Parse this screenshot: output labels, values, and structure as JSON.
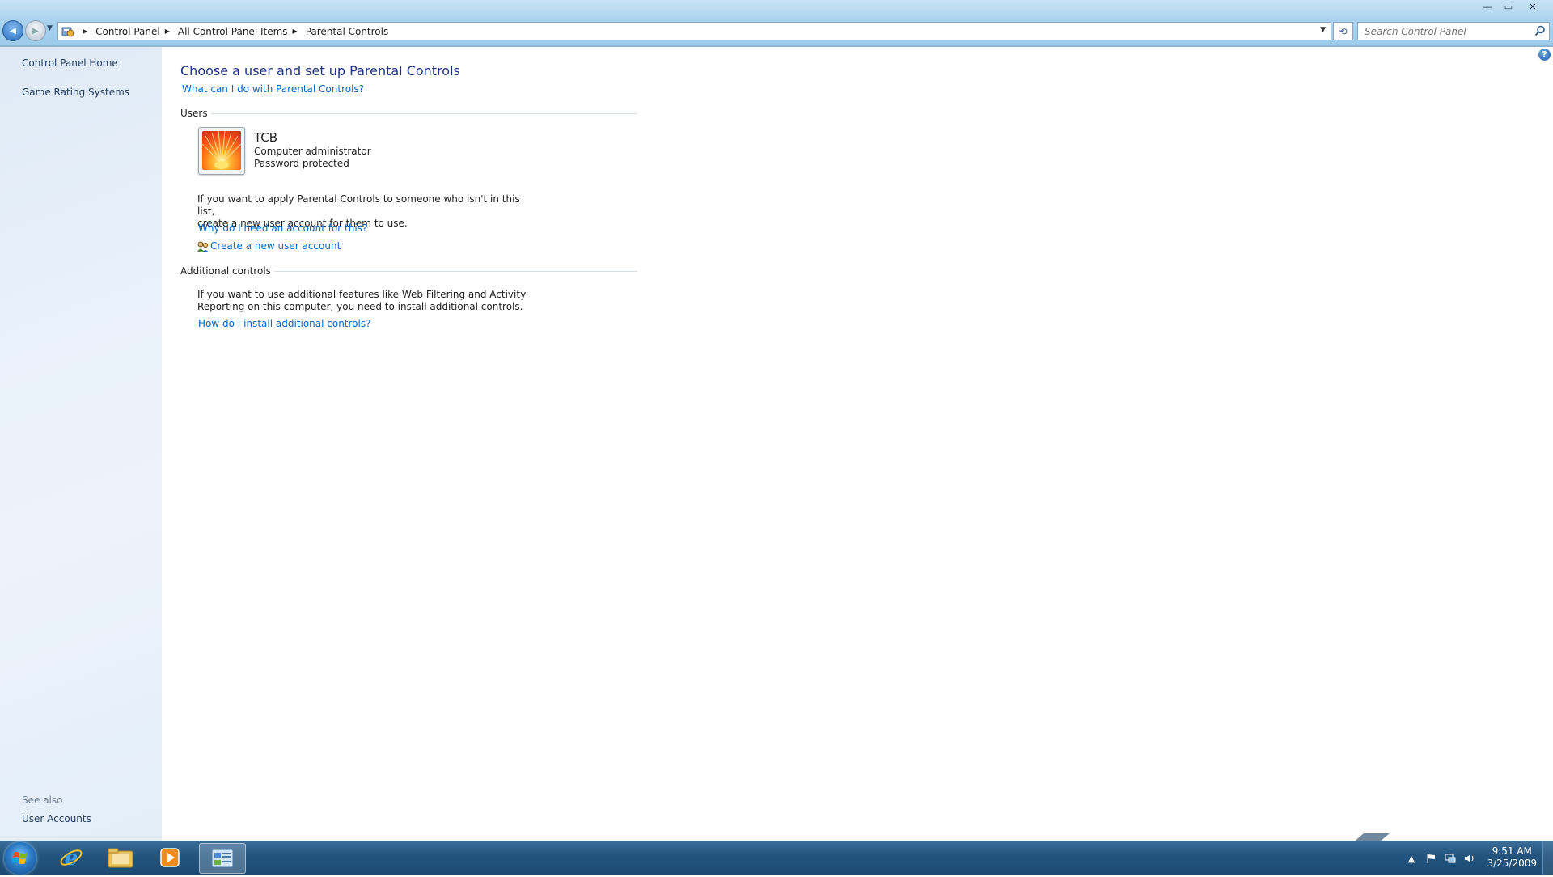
{
  "window": {
    "controls": {
      "minimize": "—",
      "maximize": "▭",
      "close": "✕"
    }
  },
  "address_bar": {
    "breadcrumbs": [
      "Control Panel",
      "All Control Panel Items",
      "Parental Controls"
    ],
    "separator": "▶",
    "back": "◀",
    "forward": "▶",
    "recent": "▼",
    "dropdown": "▼",
    "refresh": "⟲"
  },
  "search": {
    "placeholder": "Search Control Panel"
  },
  "left_nav": {
    "items": [
      {
        "label": "Control Panel Home"
      },
      {
        "label": "Game Rating Systems"
      }
    ],
    "see_also_label": "See also",
    "see_also_items": [
      {
        "label": "User Accounts"
      }
    ]
  },
  "main": {
    "help": "?",
    "title": "Choose a user and set up Parental Controls",
    "intro_link": "What can I do with Parental Controls?",
    "users_header": "Users",
    "user": {
      "name": "TCB",
      "role": "Computer administrator",
      "status": "Password protected"
    },
    "no_account_text_1": "If you want to apply Parental Controls to someone who isn't in this list,",
    "no_account_text_2": "create a new user account for them to use.",
    "why_link": "Why do I need an account for this?",
    "create_link": "Create a new user account",
    "additional_header": "Additional controls",
    "additional_text_1": "If you want to use additional features like Web Filtering and Activity",
    "additional_text_2": "Reporting on this computer, you need to install additional controls.",
    "install_link": "How do I install additional controls?"
  },
  "taskbar": {
    "pinned": [
      {
        "name": "internet-explorer"
      },
      {
        "name": "windows-explorer"
      },
      {
        "name": "media-player"
      },
      {
        "name": "control-panel",
        "active": true
      }
    ],
    "clock_time": "9:51 AM",
    "clock_date": "3/25/2009",
    "tray": {
      "show_hidden": "▲"
    }
  }
}
